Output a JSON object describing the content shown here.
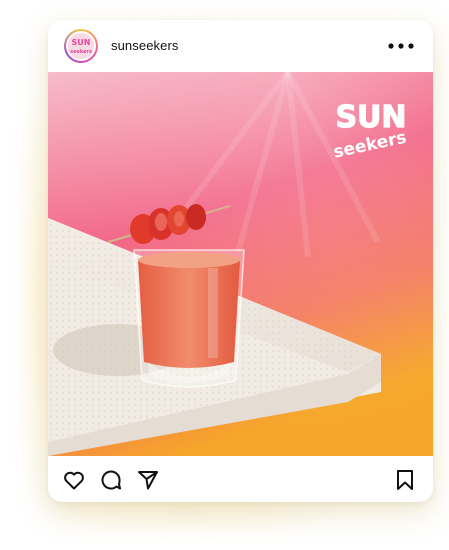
{
  "post": {
    "username": "sunseekers",
    "logo_text": "SUNSEEKERS",
    "image_subject": "strawberry-drink-on-white-block",
    "colors": {
      "gradient_top": "#f6b6c4",
      "gradient_mid": "#f1587c",
      "gradient_bottom": "#f6a62a",
      "drink": "#ea6b47",
      "strawberry": "#e23a2a",
      "ring_yellow": "#f7c83c",
      "ring_pink": "#f0569b"
    }
  },
  "icons": {
    "more": "more-horizontal-icon",
    "like": "heart-icon",
    "comment": "comment-icon",
    "share": "send-icon",
    "save": "bookmark-icon"
  }
}
